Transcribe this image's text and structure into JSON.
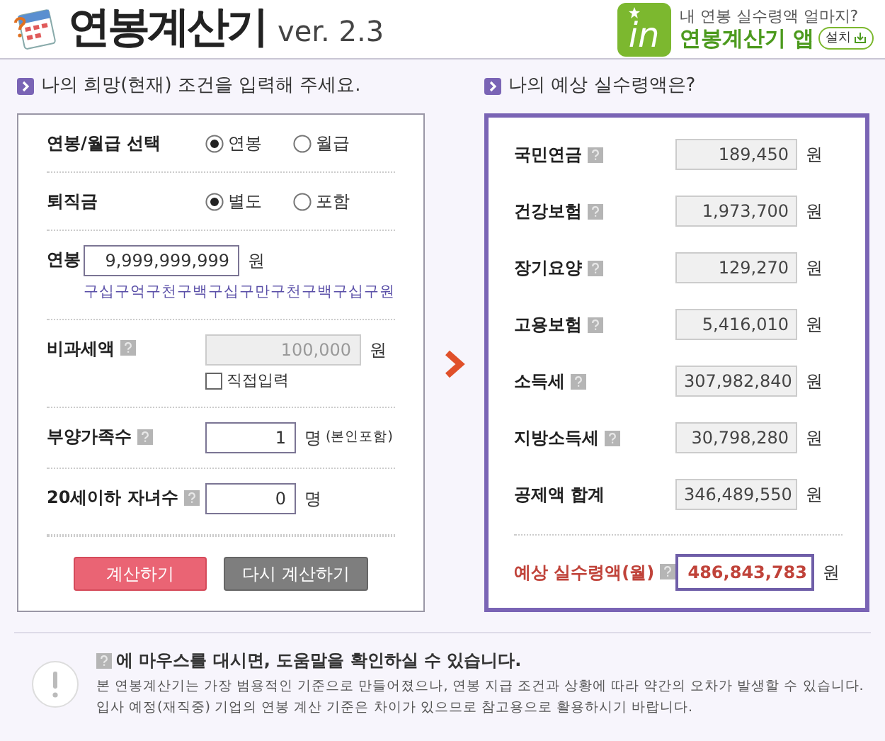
{
  "header": {
    "title": "연봉계산기",
    "version": "ver. 2.3",
    "promo": {
      "logo_text": "in",
      "tagline": "내 연봉 실수령액 얼마지?",
      "app_name": "연봉계산기 앱",
      "install": "설치"
    }
  },
  "input_panel": {
    "heading": "나의 희망(현재) 조건을 입력해 주세요.",
    "fields": [
      {
        "kind": "radio",
        "label": "연봉/월급 선택",
        "options": [
          {
            "label": "연봉",
            "selected": true
          },
          {
            "label": "월급",
            "selected": false
          }
        ]
      },
      {
        "kind": "radio",
        "label": "퇴직금",
        "options": [
          {
            "label": "별도",
            "selected": true
          },
          {
            "label": "포함",
            "selected": false
          }
        ]
      },
      {
        "kind": "input",
        "label": "연봉",
        "help": false,
        "value": "9,999,999,999",
        "unit": "원",
        "disabled": false,
        "note": "구십구억구천구백구십구만구천구백구십구원"
      },
      {
        "kind": "input",
        "label": "비과세액",
        "help": true,
        "value": "100,000",
        "unit": "원",
        "disabled": true,
        "checkbox": {
          "label": "직접입력",
          "checked": false
        }
      },
      {
        "kind": "input",
        "label": "부양가족수",
        "help": true,
        "value": "1",
        "unit": "명",
        "disabled": false,
        "unit_note": "(본인포함)"
      },
      {
        "kind": "input",
        "label": "20세이하 자녀수",
        "help": true,
        "value": "0",
        "unit": "명",
        "disabled": false
      }
    ],
    "buttons": [
      {
        "label": "계산하기",
        "kind": "primary"
      },
      {
        "label": "다시 계산하기",
        "kind": "secondary"
      }
    ]
  },
  "result_panel": {
    "heading": "나의 예상 실수령액은?",
    "rows": [
      {
        "label": "국민연금",
        "help": true,
        "value": "189,450",
        "unit": "원"
      },
      {
        "label": "건강보험",
        "help": true,
        "value": "1,973,700",
        "unit": "원"
      },
      {
        "label": "장기요양",
        "help": true,
        "value": "129,270",
        "unit": "원"
      },
      {
        "label": "고용보험",
        "help": true,
        "value": "5,416,010",
        "unit": "원"
      },
      {
        "label": "소득세",
        "help": true,
        "value": "307,982,840",
        "unit": "원"
      },
      {
        "label": "지방소득세",
        "help": true,
        "value": "30,798,280",
        "unit": "원"
      },
      {
        "label": "공제액 합계",
        "help": false,
        "value": "346,489,550",
        "unit": "원"
      }
    ],
    "total": {
      "label": "예상 실수령액(월)",
      "help": true,
      "value": "486,843,783",
      "unit": "원"
    }
  },
  "footer": {
    "help_hint": "에 마우스를 대시면, 도움말을 확인하실 수 있습니다.",
    "notes": [
      "본 연봉계산기는 가장 범용적인 기준으로 만들어졌으나, 연봉 지급 조건과 상황에 따라 약간의 오차가 발생할 수 있습니다.",
      "입사 예정(재직중) 기업의 연봉 계산 기준은 차이가 있으므로 참고용으로 활용하시기 바랍니다."
    ]
  }
}
